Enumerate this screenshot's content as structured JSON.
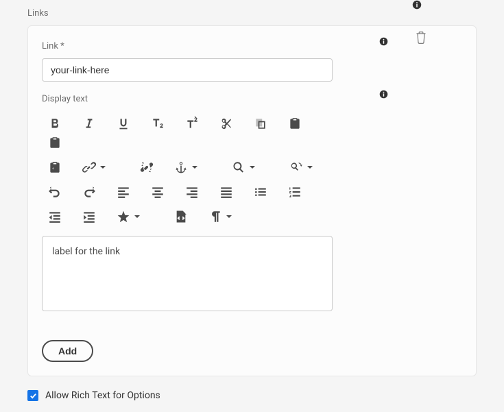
{
  "section": {
    "title": "Links"
  },
  "item": {
    "link": {
      "label": "Link *",
      "value": "your-link-here"
    },
    "displayText": {
      "label": "Display text",
      "value": "label for the link"
    },
    "addButton": "Add"
  },
  "checkbox": {
    "label": "Allow Rich Text for Options",
    "checked": true
  }
}
